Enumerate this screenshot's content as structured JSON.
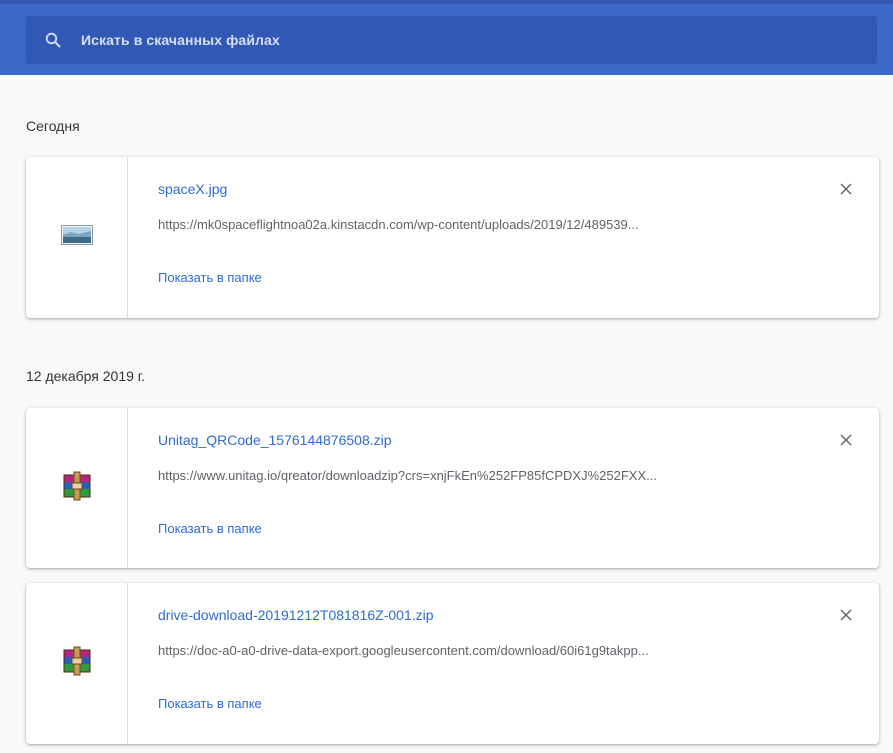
{
  "search": {
    "placeholder": "Искать в скачанных файлах"
  },
  "colors": {
    "header": "#3c68c8",
    "search_box": "#3158b5",
    "link": "#2f6bd2"
  },
  "groups": [
    {
      "date": "Сегодня",
      "items": [
        {
          "name": "spaceX.jpg",
          "url": "https://mk0spaceflightnoa02a.kinstacdn.com/wp-content/uploads/2019/12/489539...",
          "action": "Показать в папке",
          "icon": "image-file-icon"
        }
      ]
    },
    {
      "date": "12 декабря 2019 г.",
      "items": [
        {
          "name": "Unitag_QRCode_1576144876508.zip",
          "url": "https://www.unitag.io/qreator/downloadzip?crs=xnjFkEn%252FP85fCPDXJ%252FXX...",
          "action": "Показать в папке",
          "icon": "archive-file-icon"
        },
        {
          "name": "drive-download-20191212T081816Z-001.zip",
          "url": "https://doc-a0-a0-drive-data-export.googleusercontent.com/download/60i61g9takpp...",
          "action": "Показать в папке",
          "icon": "archive-file-icon"
        }
      ]
    }
  ]
}
